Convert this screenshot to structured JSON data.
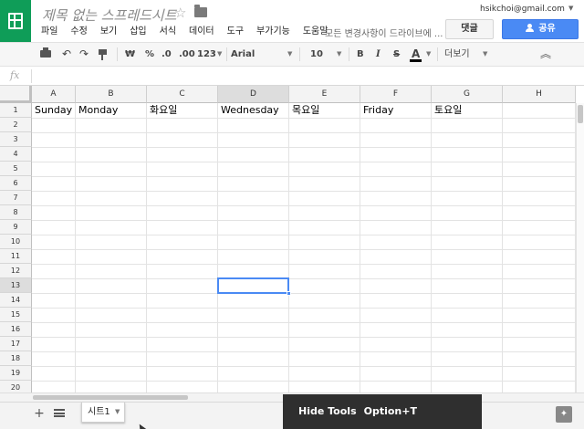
{
  "app": {
    "title": "제목 없는 스프레드시트",
    "save_status": "모든 변경사항이 드라이브에 ...",
    "account_email": "hsikchoi@gmail.com"
  },
  "menu": [
    "파일",
    "수정",
    "보기",
    "삽입",
    "서식",
    "데이터",
    "도구",
    "부가기능",
    "도움말"
  ],
  "buttons": {
    "comments": "댓글",
    "share": "공유"
  },
  "toolbar": {
    "currency": "₩",
    "percent": "%",
    "decrease_decimal": ".0",
    "increase_decimal": ".00",
    "number_format": "123",
    "font_family": "Arial",
    "font_size": "10",
    "bold": "B",
    "italic": "I",
    "strike": "S",
    "text_color": "A",
    "more": "더보기"
  },
  "formula_bar": {
    "fx_label": "fx",
    "value": ""
  },
  "grid": {
    "columns": [
      "A",
      "B",
      "C",
      "D",
      "E",
      "F",
      "G",
      "H"
    ],
    "rows": [
      "1",
      "2",
      "3",
      "4",
      "5",
      "6",
      "7",
      "8",
      "9",
      "10",
      "11",
      "12",
      "13",
      "14",
      "15",
      "16",
      "17",
      "18",
      "19",
      "20"
    ],
    "row1": [
      "Sunday",
      "Monday",
      "화요일",
      "Wednesday",
      "목요일",
      "Friday",
      "토요일",
      ""
    ],
    "active_cell": "D13"
  },
  "sheets": [
    {
      "name": "시트1"
    }
  ],
  "tooltip": {
    "label": "Hide Tools",
    "shortcut": "Option+T"
  },
  "colors": {
    "brand_green": "#0f9d58",
    "share_blue": "#4a8af4",
    "selection_blue": "#4a8af4",
    "tooltip_bg": "#2f2f2f"
  },
  "icons": {
    "logo": "sheets-logo-icon",
    "star": "star-icon",
    "folder": "folder-icon",
    "print": "print-icon",
    "undo": "undo-icon",
    "redo": "redo-icon",
    "paint_format": "paint-format-icon",
    "collapse": "chevron-up-double-icon",
    "add_sheet": "plus-icon",
    "sheet_list": "list-icon",
    "explore": "explore-icon"
  }
}
